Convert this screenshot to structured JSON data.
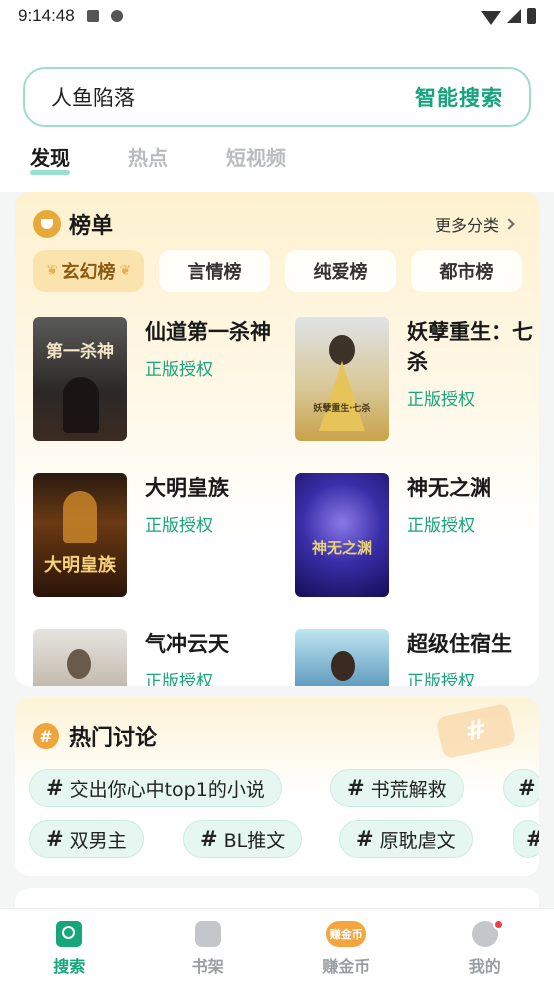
{
  "status": {
    "time": "9:14:48"
  },
  "search": {
    "value": "人鱼陷落",
    "action": "智能搜索"
  },
  "tabs": [
    {
      "label": "发现",
      "active": true
    },
    {
      "label": "热点",
      "active": false
    },
    {
      "label": "短视频",
      "active": false
    }
  ],
  "ranking": {
    "title": "榜单",
    "more": "更多分类",
    "categories": [
      {
        "label": "玄幻榜",
        "active": true
      },
      {
        "label": "言情榜",
        "active": false
      },
      {
        "label": "纯爱榜",
        "active": false
      },
      {
        "label": "都市榜",
        "active": false
      }
    ],
    "books": [
      {
        "title": "仙道第一杀神",
        "tag": "正版授权",
        "cover_text": "第一杀神"
      },
      {
        "title": "妖孽重生：七杀",
        "tag": "正版授权",
        "cover_text": "妖孽重生·七杀"
      },
      {
        "title": "大明皇族",
        "tag": "正版授权",
        "cover_text": "大明皇族"
      },
      {
        "title": "神无之渊",
        "tag": "正版授权",
        "cover_text": "神无之渊"
      },
      {
        "title": "气冲云天",
        "tag": "正版授权",
        "cover_text": ""
      },
      {
        "title": "超级住宿生",
        "tag": "正版授权",
        "cover_text": ""
      }
    ]
  },
  "hot": {
    "title": "热门讨论",
    "tags": [
      "交出你心中top1的小说",
      "书荒解救",
      "双男主",
      "BL推文",
      "原耽虐文"
    ]
  },
  "nav": [
    {
      "label": "搜索",
      "active": true
    },
    {
      "label": "书架",
      "active": false
    },
    {
      "label": "赚金币",
      "active": false,
      "badge_text": "赚金币"
    },
    {
      "label": "我的",
      "active": false
    }
  ],
  "colors": {
    "accent": "#17a57c",
    "rank_bg": "#fdf1cf",
    "tag_bg": "#e6f7f2"
  }
}
